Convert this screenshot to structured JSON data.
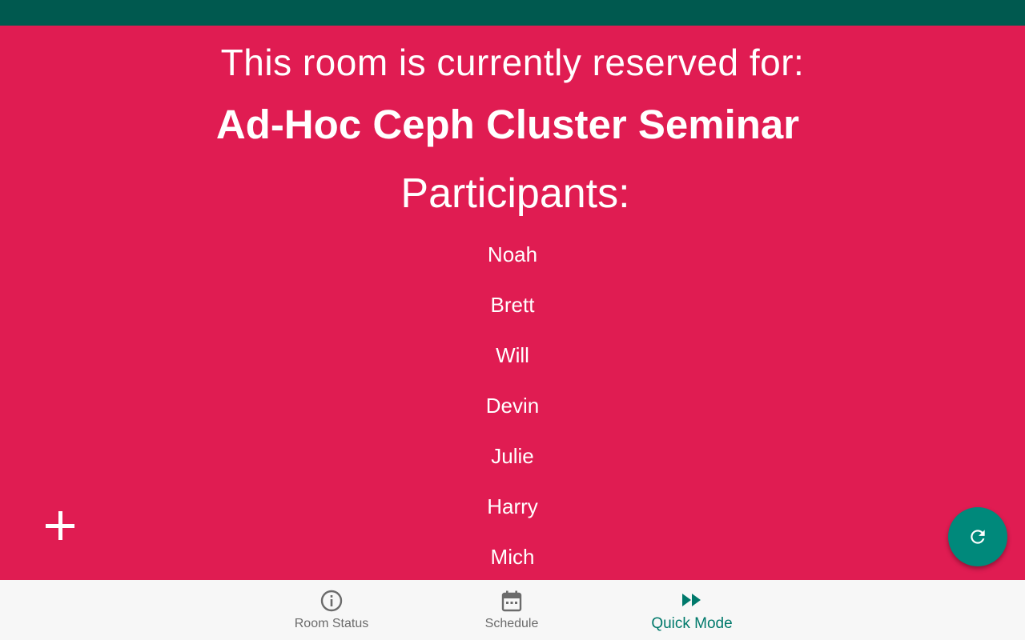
{
  "colors": {
    "status_bar": "#00594f",
    "reserved_background": "#e01c52",
    "accent": "#00897b",
    "active_nav": "#00796b",
    "inactive_nav": "#6b6b6b",
    "nav_background": "#f7f7f7"
  },
  "reservation": {
    "label": "This room is currently reserved for:",
    "meeting_title": "Ad-Hoc Ceph Cluster Seminar",
    "participants_heading": "Participants:",
    "participants": [
      "Noah",
      "Brett",
      "Will",
      "Devin",
      "Julie",
      "Harry",
      "Mich"
    ]
  },
  "actions": {
    "add_icon": "plus-icon",
    "refresh_icon": "refresh-icon"
  },
  "bottom_nav": {
    "items": [
      {
        "label": "Room Status",
        "icon": "info-icon",
        "active": false
      },
      {
        "label": "Schedule",
        "icon": "calendar-icon",
        "active": false
      },
      {
        "label": "Quick Mode",
        "icon": "fast-forward-icon",
        "active": true
      }
    ]
  }
}
